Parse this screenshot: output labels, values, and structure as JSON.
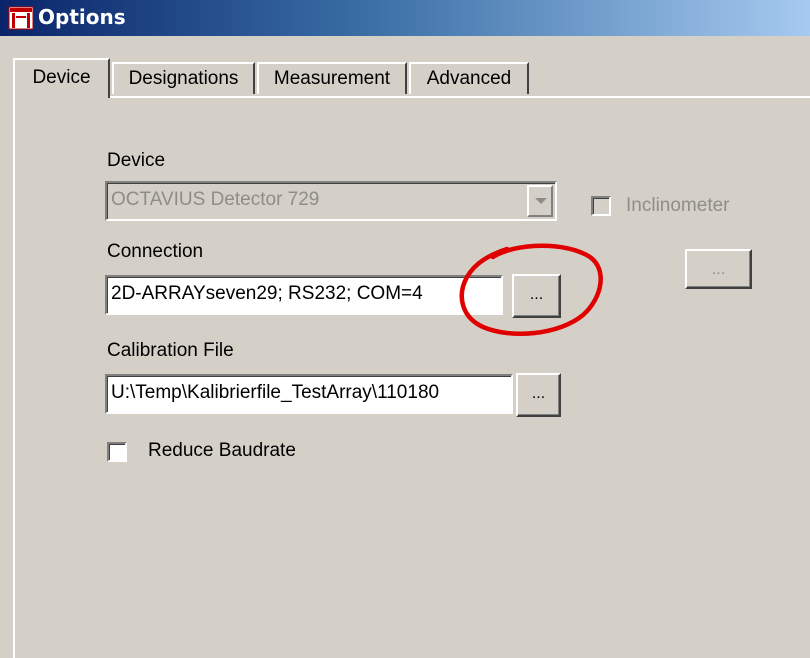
{
  "window": {
    "title": "Options"
  },
  "tabs": [
    {
      "label": "Device",
      "active": true
    },
    {
      "label": "Designations",
      "active": false
    },
    {
      "label": "Measurement",
      "active": false
    },
    {
      "label": "Advanced",
      "active": false
    }
  ],
  "device": {
    "label": "Device",
    "value": "OCTAVIUS Detector 729",
    "enabled": false
  },
  "inclinometer": {
    "label": "Inclinometer",
    "checked": false,
    "enabled": false
  },
  "inclinometer_button": {
    "label": "...",
    "enabled": false
  },
  "connection": {
    "label": "Connection",
    "value": "2D-ARRAYseven29; RS232; COM=4",
    "browse_label": "..."
  },
  "calibration": {
    "label": "Calibration File",
    "value": "U:\\Temp\\Kalibrierfile_TestArray\\110180",
    "browse_label": "..."
  },
  "reduce_baudrate": {
    "label": "Reduce Baudrate",
    "checked": false
  },
  "colors": {
    "title_bar_start": "#0a246a",
    "title_bar_end": "#a6caf0",
    "face": "#d4d0c8",
    "disabled_text": "#8f8d88",
    "annotation": "#e00000"
  },
  "icons": {
    "app": "options-app-icon",
    "combo_arrow": "chevron-down-icon"
  }
}
